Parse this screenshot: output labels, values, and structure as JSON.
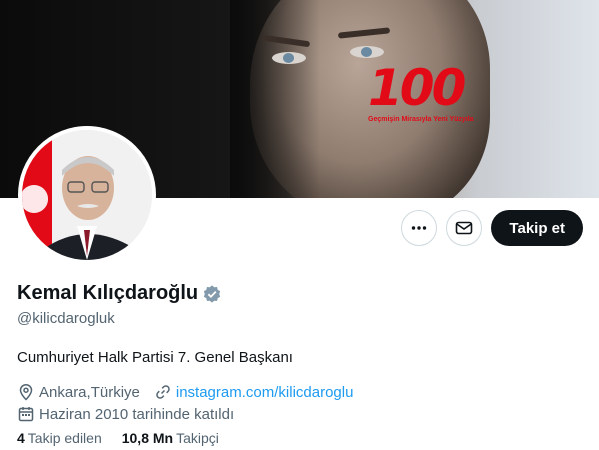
{
  "banner": {
    "logo_number": "100",
    "logo_tagline": "Geçmişin Mirasıyla Yeni Yüzyıla"
  },
  "actions": {
    "more_icon": "more-horizontal-icon",
    "message_icon": "mail-icon",
    "follow_label": "Takip et"
  },
  "profile": {
    "display_name": "Kemal Kılıçdaroğlu",
    "verified_icon": "verified-badge-icon",
    "handle": "@kilicdarogluk",
    "bio": "Cumhuriyet Halk Partisi 7. Genel Başkanı",
    "location": "Ankara,Türkiye",
    "website": "instagram.com/kilicdaroglu",
    "joined": "Haziran 2010 tarihinde katıldı"
  },
  "stats": {
    "following_count": "4",
    "following_label": "Takip edilen",
    "followers_count": "10,8 Mn",
    "followers_label": "Takipçi"
  },
  "colors": {
    "accent": "#1d9bf0",
    "brand_red": "#e30a17",
    "text_primary": "#0f1419",
    "text_secondary": "#536471",
    "follow_button_bg": "#0f1419",
    "verified_badge": "#829aab"
  }
}
